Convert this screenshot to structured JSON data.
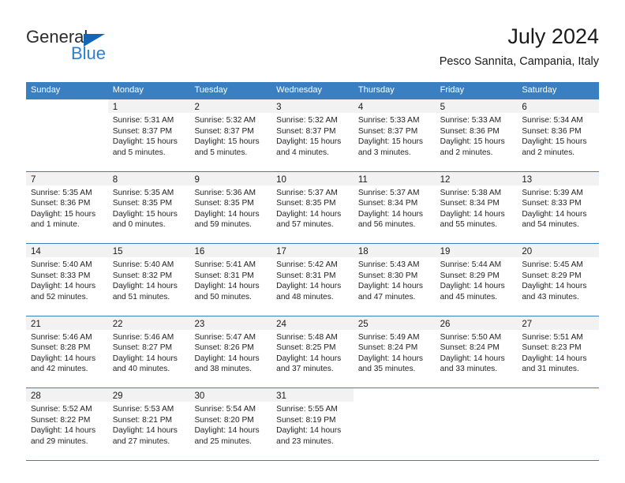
{
  "brand": {
    "name_top": "General",
    "name_bottom": "Blue",
    "triangle_color": "#1565b5",
    "blue_color": "#2a7fd4"
  },
  "header": {
    "title": "July 2024",
    "subtitle": "Pesco Sannita, Campania, Italy"
  },
  "theme": {
    "header_blue": "#3a7fc1",
    "day_band_gray": "#f2f2f2"
  },
  "weekdays": [
    "Sunday",
    "Monday",
    "Tuesday",
    "Wednesday",
    "Thursday",
    "Friday",
    "Saturday"
  ],
  "weeks": [
    [
      {
        "day": "",
        "lines": []
      },
      {
        "day": "1",
        "lines": [
          "Sunrise: 5:31 AM",
          "Sunset: 8:37 PM",
          "Daylight: 15 hours",
          "and 5 minutes."
        ]
      },
      {
        "day": "2",
        "lines": [
          "Sunrise: 5:32 AM",
          "Sunset: 8:37 PM",
          "Daylight: 15 hours",
          "and 5 minutes."
        ]
      },
      {
        "day": "3",
        "lines": [
          "Sunrise: 5:32 AM",
          "Sunset: 8:37 PM",
          "Daylight: 15 hours",
          "and 4 minutes."
        ]
      },
      {
        "day": "4",
        "lines": [
          "Sunrise: 5:33 AM",
          "Sunset: 8:37 PM",
          "Daylight: 15 hours",
          "and 3 minutes."
        ]
      },
      {
        "day": "5",
        "lines": [
          "Sunrise: 5:33 AM",
          "Sunset: 8:36 PM",
          "Daylight: 15 hours",
          "and 2 minutes."
        ]
      },
      {
        "day": "6",
        "lines": [
          "Sunrise: 5:34 AM",
          "Sunset: 8:36 PM",
          "Daylight: 15 hours",
          "and 2 minutes."
        ]
      }
    ],
    [
      {
        "day": "7",
        "lines": [
          "Sunrise: 5:35 AM",
          "Sunset: 8:36 PM",
          "Daylight: 15 hours",
          "and 1 minute."
        ]
      },
      {
        "day": "8",
        "lines": [
          "Sunrise: 5:35 AM",
          "Sunset: 8:35 PM",
          "Daylight: 15 hours",
          "and 0 minutes."
        ]
      },
      {
        "day": "9",
        "lines": [
          "Sunrise: 5:36 AM",
          "Sunset: 8:35 PM",
          "Daylight: 14 hours",
          "and 59 minutes."
        ]
      },
      {
        "day": "10",
        "lines": [
          "Sunrise: 5:37 AM",
          "Sunset: 8:35 PM",
          "Daylight: 14 hours",
          "and 57 minutes."
        ]
      },
      {
        "day": "11",
        "lines": [
          "Sunrise: 5:37 AM",
          "Sunset: 8:34 PM",
          "Daylight: 14 hours",
          "and 56 minutes."
        ]
      },
      {
        "day": "12",
        "lines": [
          "Sunrise: 5:38 AM",
          "Sunset: 8:34 PM",
          "Daylight: 14 hours",
          "and 55 minutes."
        ]
      },
      {
        "day": "13",
        "lines": [
          "Sunrise: 5:39 AM",
          "Sunset: 8:33 PM",
          "Daylight: 14 hours",
          "and 54 minutes."
        ]
      }
    ],
    [
      {
        "day": "14",
        "lines": [
          "Sunrise: 5:40 AM",
          "Sunset: 8:33 PM",
          "Daylight: 14 hours",
          "and 52 minutes."
        ]
      },
      {
        "day": "15",
        "lines": [
          "Sunrise: 5:40 AM",
          "Sunset: 8:32 PM",
          "Daylight: 14 hours",
          "and 51 minutes."
        ]
      },
      {
        "day": "16",
        "lines": [
          "Sunrise: 5:41 AM",
          "Sunset: 8:31 PM",
          "Daylight: 14 hours",
          "and 50 minutes."
        ]
      },
      {
        "day": "17",
        "lines": [
          "Sunrise: 5:42 AM",
          "Sunset: 8:31 PM",
          "Daylight: 14 hours",
          "and 48 minutes."
        ]
      },
      {
        "day": "18",
        "lines": [
          "Sunrise: 5:43 AM",
          "Sunset: 8:30 PM",
          "Daylight: 14 hours",
          "and 47 minutes."
        ]
      },
      {
        "day": "19",
        "lines": [
          "Sunrise: 5:44 AM",
          "Sunset: 8:29 PM",
          "Daylight: 14 hours",
          "and 45 minutes."
        ]
      },
      {
        "day": "20",
        "lines": [
          "Sunrise: 5:45 AM",
          "Sunset: 8:29 PM",
          "Daylight: 14 hours",
          "and 43 minutes."
        ]
      }
    ],
    [
      {
        "day": "21",
        "lines": [
          "Sunrise: 5:46 AM",
          "Sunset: 8:28 PM",
          "Daylight: 14 hours",
          "and 42 minutes."
        ]
      },
      {
        "day": "22",
        "lines": [
          "Sunrise: 5:46 AM",
          "Sunset: 8:27 PM",
          "Daylight: 14 hours",
          "and 40 minutes."
        ]
      },
      {
        "day": "23",
        "lines": [
          "Sunrise: 5:47 AM",
          "Sunset: 8:26 PM",
          "Daylight: 14 hours",
          "and 38 minutes."
        ]
      },
      {
        "day": "24",
        "lines": [
          "Sunrise: 5:48 AM",
          "Sunset: 8:25 PM",
          "Daylight: 14 hours",
          "and 37 minutes."
        ]
      },
      {
        "day": "25",
        "lines": [
          "Sunrise: 5:49 AM",
          "Sunset: 8:24 PM",
          "Daylight: 14 hours",
          "and 35 minutes."
        ]
      },
      {
        "day": "26",
        "lines": [
          "Sunrise: 5:50 AM",
          "Sunset: 8:24 PM",
          "Daylight: 14 hours",
          "and 33 minutes."
        ]
      },
      {
        "day": "27",
        "lines": [
          "Sunrise: 5:51 AM",
          "Sunset: 8:23 PM",
          "Daylight: 14 hours",
          "and 31 minutes."
        ]
      }
    ],
    [
      {
        "day": "28",
        "lines": [
          "Sunrise: 5:52 AM",
          "Sunset: 8:22 PM",
          "Daylight: 14 hours",
          "and 29 minutes."
        ]
      },
      {
        "day": "29",
        "lines": [
          "Sunrise: 5:53 AM",
          "Sunset: 8:21 PM",
          "Daylight: 14 hours",
          "and 27 minutes."
        ]
      },
      {
        "day": "30",
        "lines": [
          "Sunrise: 5:54 AM",
          "Sunset: 8:20 PM",
          "Daylight: 14 hours",
          "and 25 minutes."
        ]
      },
      {
        "day": "31",
        "lines": [
          "Sunrise: 5:55 AM",
          "Sunset: 8:19 PM",
          "Daylight: 14 hours",
          "and 23 minutes."
        ]
      },
      {
        "day": "",
        "lines": []
      },
      {
        "day": "",
        "lines": []
      },
      {
        "day": "",
        "lines": []
      }
    ]
  ]
}
